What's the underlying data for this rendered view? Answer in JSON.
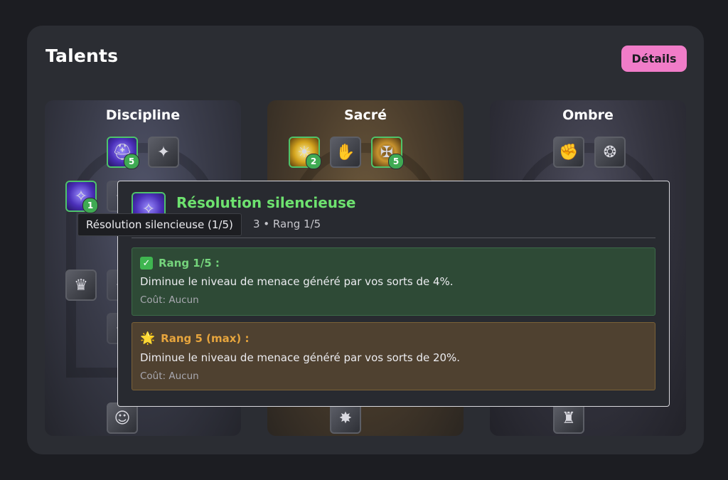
{
  "header": {
    "title": "Talents",
    "details_label": "Détails"
  },
  "trees": [
    {
      "name": "Discipline"
    },
    {
      "name": "Sacré"
    },
    {
      "name": "Ombre"
    }
  ],
  "icons": {
    "discipline_row1_a": {
      "icon": "helmet-icon",
      "rank": "5"
    },
    "discipline_row1_b": {
      "icon": "wand-icon"
    },
    "discipline_row2_a": {
      "icon": "silent-resolve-icon",
      "rank": "1"
    },
    "sacre_row1_a": {
      "icon": "holy-orb-icon",
      "rank": "2"
    },
    "sacre_row1_b": {
      "icon": "hand-icon"
    },
    "sacre_row1_c": {
      "icon": "holy-emblem-icon",
      "rank": "5"
    },
    "ombre_row1_a": {
      "icon": "shadow-hand-icon"
    },
    "ombre_row1_b": {
      "icon": "shadow-swirl-icon"
    }
  },
  "tooltip": {
    "title": "Résolution silencieuse",
    "subtitle": "3 • Rang 1/5",
    "current": {
      "heading": "Rang 1/5 :",
      "description": "Diminue le niveau de menace généré par vos sorts de 4%.",
      "cost": "Coût: Aucun"
    },
    "max": {
      "heading": "Rang 5 (max) :",
      "description": "Diminue le niveau de menace généré par vos sorts de 20%.",
      "cost": "Coût: Aucun"
    }
  },
  "hover_tip": "Résolution silencieuse (1/5)",
  "colors": {
    "accent": "#f07cc8",
    "rank_green": "#4fc36a",
    "title_green": "#6ee26f",
    "max_orange": "#e7a53d"
  }
}
